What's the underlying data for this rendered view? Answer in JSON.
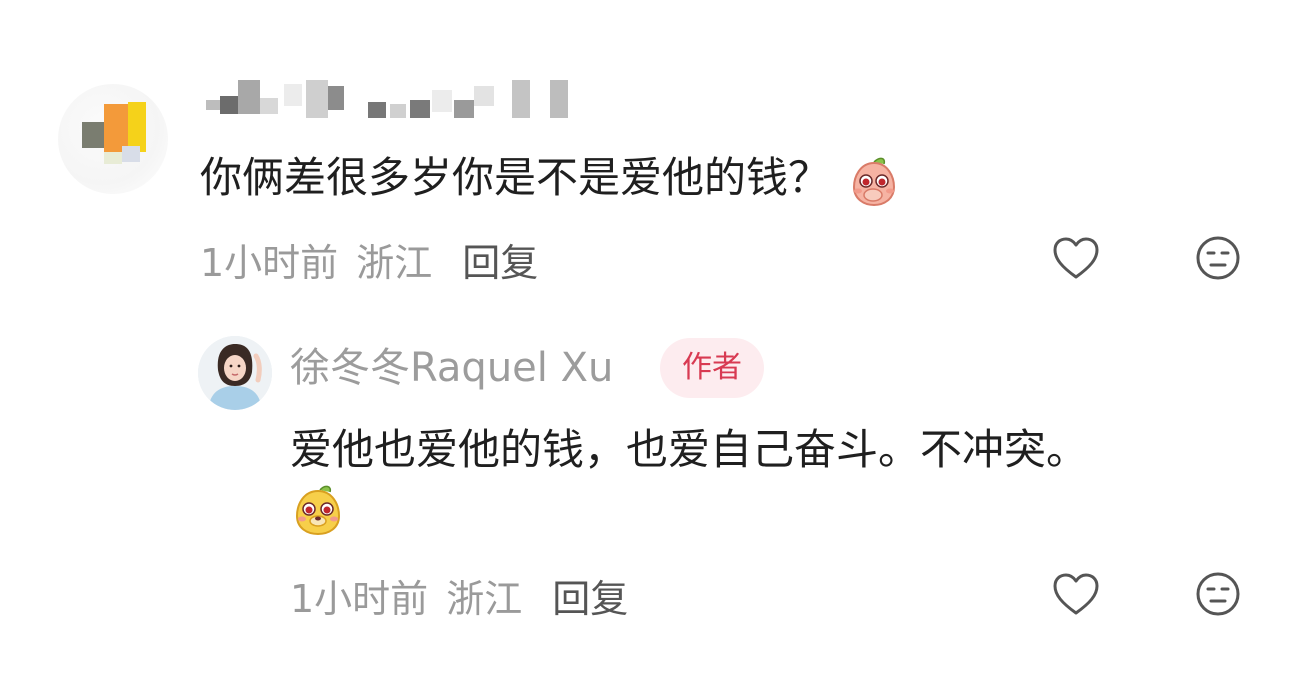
{
  "comment": {
    "text": "你俩差很多岁你是不是爱他的钱？",
    "emoji": "shy-peach-emoji",
    "time": "1小时前",
    "location": "浙江",
    "reply_label": "回复",
    "like_icon": "heart-outline-icon",
    "dislike_icon": "meh-face-icon"
  },
  "reply": {
    "username": "徐冬冬Raquel Xu",
    "badge": "作者",
    "text": "爱他也爱他的钱，也爱自己奋斗。不冲突。",
    "emoji": "smiling-mango-emoji",
    "time": "1小时前",
    "location": "浙江",
    "reply_label": "回复",
    "like_icon": "heart-outline-icon",
    "dislike_icon": "meh-face-icon"
  },
  "colors": {
    "meta_gray": "#9a9a9a",
    "badge_bg": "#fdecef",
    "badge_text": "#d83a52",
    "icon_gray": "#555555"
  }
}
